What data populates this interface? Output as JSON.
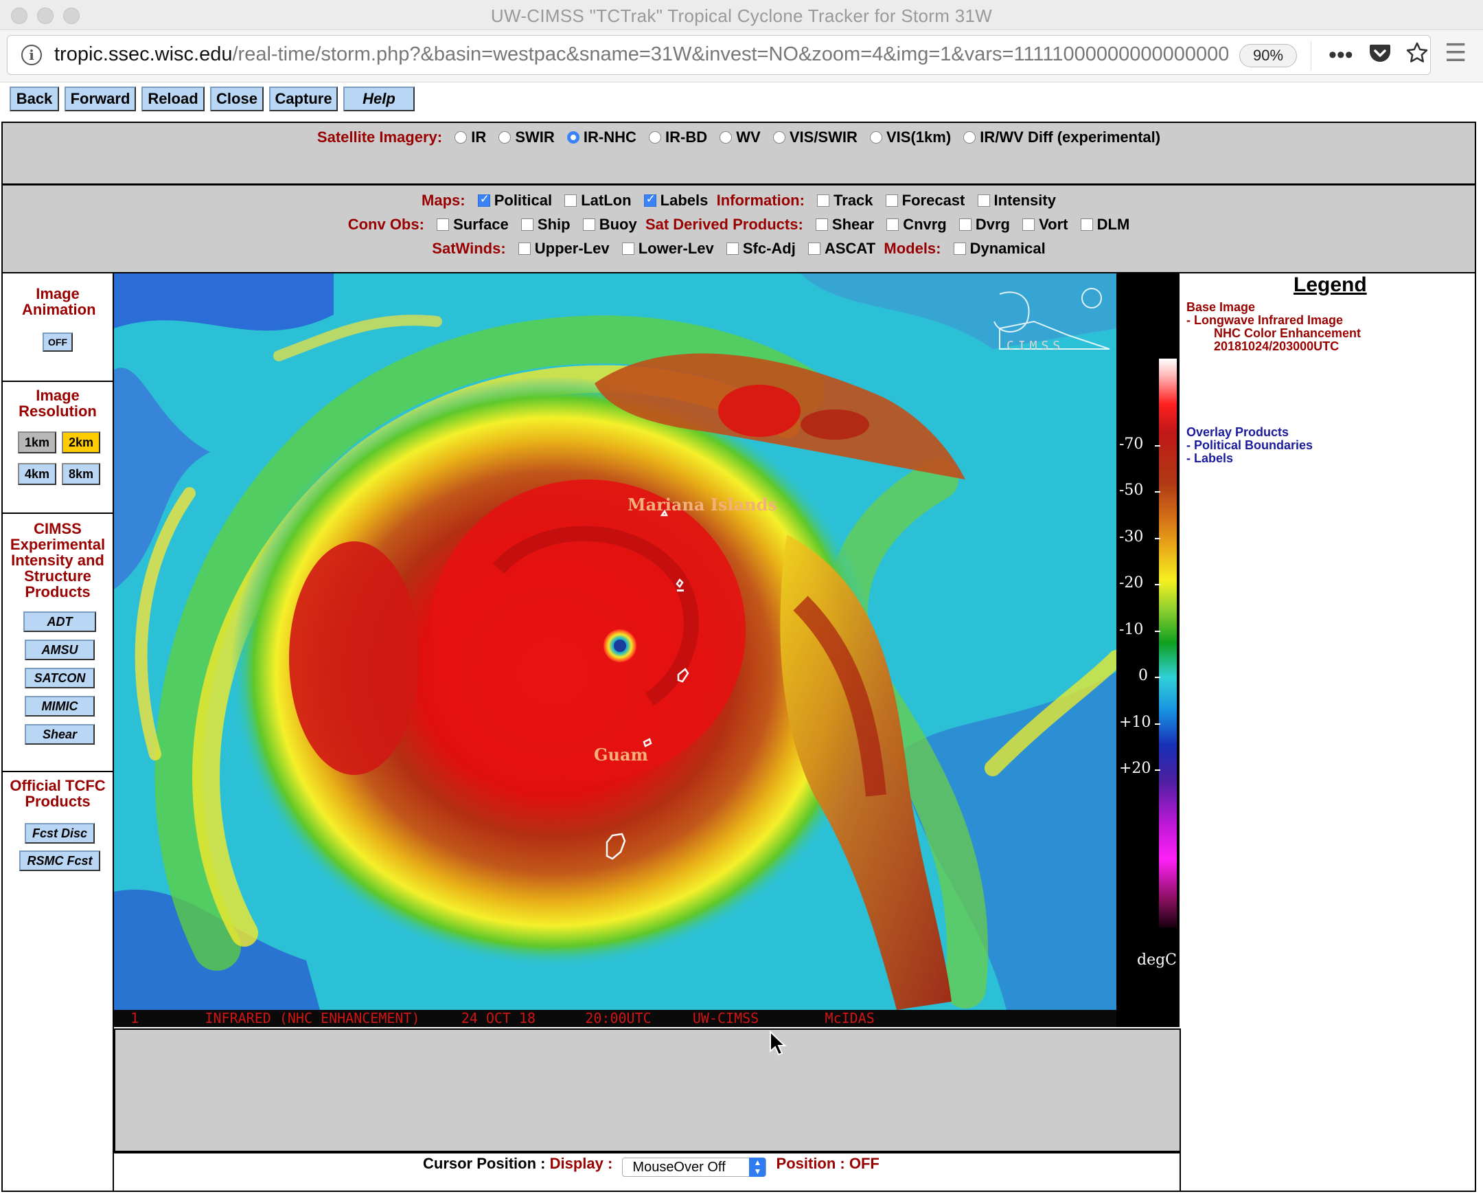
{
  "window": {
    "title": "UW-CIMSS \"TCTrak\" Tropical Cyclone Tracker for Storm 31W"
  },
  "browser": {
    "url_host": "tropic.ssec.wisc.edu",
    "url_path": "/real-time/storm.php?&basin=westpac&sname=31W&invest=NO&zoom=4&img=1&vars=11111000000000000000",
    "zoom_level": "90%",
    "icons": [
      "info-icon",
      "more-icon",
      "pocket-icon",
      "bookmark-star-icon",
      "hamburger-menu-icon"
    ]
  },
  "nav_buttons": {
    "back": "Back",
    "forward": "Forward",
    "reload": "Reload",
    "close": "Close",
    "capture": "Capture",
    "help": "Help"
  },
  "satellite_imagery": {
    "label": "Satellite Imagery:",
    "options": [
      "IR",
      "SWIR",
      "IR-NHC",
      "IR-BD",
      "WV",
      "VIS/SWIR",
      "VIS(1km)",
      "IR/WV Diff (experimental)"
    ],
    "selected": "IR-NHC"
  },
  "options": {
    "maps_label": "Maps:",
    "political": "Political",
    "latlon": "LatLon",
    "labels": "Labels",
    "information_label": "Information:",
    "track": "Track",
    "forecast": "Forecast",
    "intensity": "Intensity",
    "conv_obs_label": "Conv Obs:",
    "surface": "Surface",
    "ship": "Ship",
    "buoy": "Buoy",
    "sat_derived_label": "Sat Derived Products:",
    "shear": "Shear",
    "cnvrg": "Cnvrg",
    "dvrg": "Dvrg",
    "vort": "Vort",
    "dlm": "DLM",
    "satwinds_label": "SatWinds:",
    "upper_lev": "Upper-Lev",
    "lower_lev": "Lower-Lev",
    "sfc_adj": "Sfc-Adj",
    "ascat": "ASCAT",
    "models_label": "Models:",
    "dynamical": "Dynamical",
    "checked": [
      "Political",
      "Labels"
    ]
  },
  "sidebar": {
    "animation_title": "Image Animation",
    "animation_off": "OFF",
    "resolution_title": "Image Resolution",
    "res_1km": "1km",
    "res_2km": "2km",
    "res_4km": "4km",
    "res_8km": "8km",
    "resolution_selected": "2km",
    "cimss_title": "CIMSS Experimental Intensity and Structure Products",
    "adt": "ADT",
    "amsu": "AMSU",
    "satcon": "SATCON",
    "mimic": "MIMIC",
    "shear": "Shear",
    "official_title": "Official TCFC Products",
    "fcst_disc": "Fcst Disc",
    "rsmc_fcst": "RSMC Fcst"
  },
  "image": {
    "label_mariana": "Mariana Islands",
    "label_guam": "Guam",
    "logo_text": "CIMSS",
    "footer": "  1        INFRARED (NHC ENHANCEMENT)     24 OCT 18      20:00UTC     UW-CIMSS        McIDAS"
  },
  "colorbar": {
    "ticks": [
      "-70",
      "-50",
      "-30",
      "-20",
      "-10",
      "0",
      "+10",
      "+20"
    ],
    "unit": "degC"
  },
  "legend": {
    "title": "Legend",
    "base_image": "Base Image",
    "base_line1": "-   Longwave Infrared Image",
    "base_line2": "NHC Color Enhancement",
    "base_line3": "20181024/203000UTC",
    "overlay": "Overlay Products",
    "overlay_line1": "-  Political Boundaries",
    "overlay_line2": "-  Labels"
  },
  "cursor": {
    "label": "Cursor Position :",
    "display_label": "Display :",
    "select_value": "MouseOver Off",
    "position_label": "Position : OFF"
  },
  "colors": {
    "button_blue": "#b9d7f4",
    "label_red": "#990000",
    "selected_yellow": "#ffcc00",
    "panel_grey": "#cccccc",
    "navy": "#1a1a9c"
  }
}
